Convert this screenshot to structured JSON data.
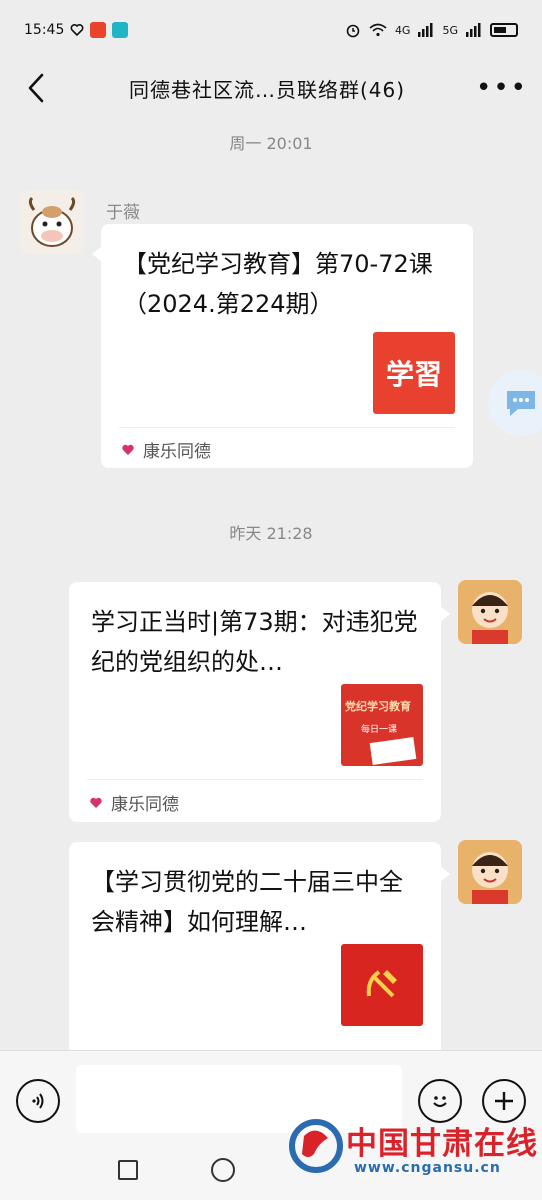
{
  "status_bar": {
    "time": "15:45",
    "signal1": "4G",
    "signal2": "5G"
  },
  "header": {
    "title": "同德巷社区流…员联络群(46)",
    "more": "•••"
  },
  "timestamps": [
    "周一 20:01",
    "昨天 21:28"
  ],
  "messages": [
    {
      "sender": "于薇",
      "title": "【党纪学习教育】第70-72课（2024.第224期）",
      "thumb_text": "学習",
      "source": "康乐同德"
    },
    {
      "title": "学习正当时|第73期：对违犯党纪的党组织的处…",
      "thumb_text": "党纪学习教育",
      "thumb_sub": "每日一课",
      "source": "康乐同德"
    },
    {
      "title": "【学习贯彻党的二十届三中全会精神】如何理解…"
    }
  ],
  "watermark": {
    "name": "中国甘肃在线",
    "url": "www.cngansu.cn"
  },
  "colors": {
    "background": "#ededed",
    "card": "#ffffff",
    "thumb_red": "#e8412f",
    "brand_red": "#d9222a",
    "brand_blue": "#2b6cb0"
  }
}
